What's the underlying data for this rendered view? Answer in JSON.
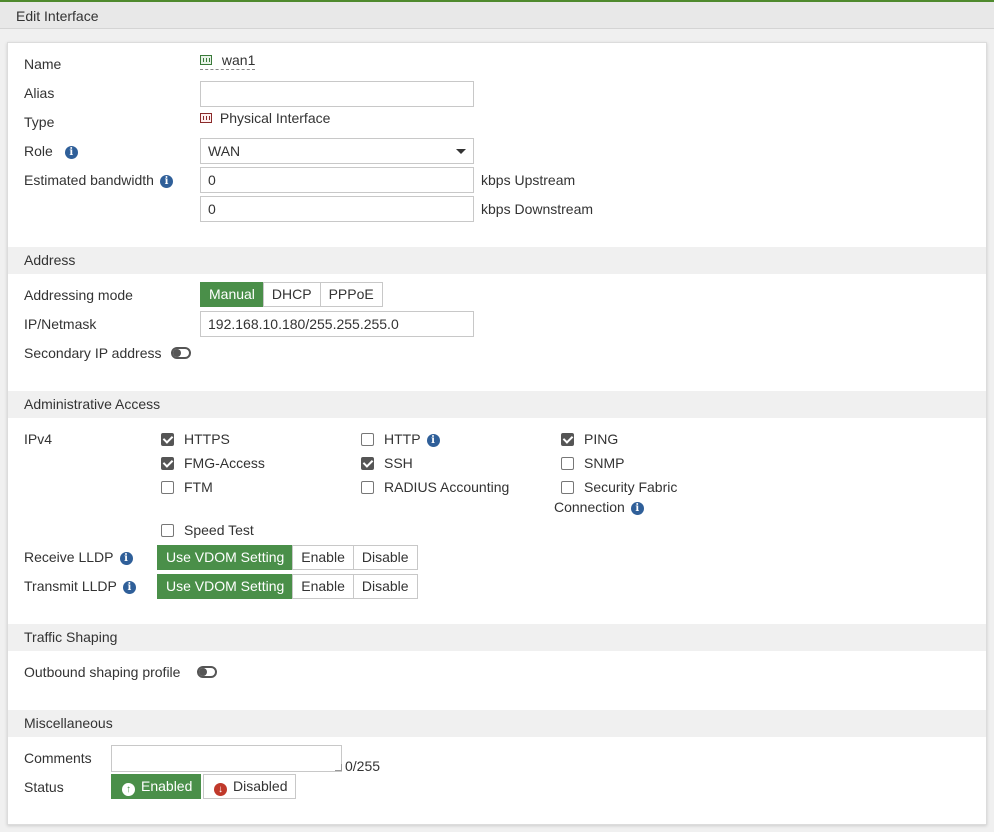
{
  "header": {
    "title": "Edit Interface"
  },
  "interface": {
    "name_label": "Name",
    "name_value": "wan1",
    "alias_label": "Alias",
    "alias_value": "",
    "type_label": "Type",
    "type_value": "Physical Interface",
    "role_label": "Role",
    "role_value": "WAN",
    "bandwidth_label": "Estimated bandwidth",
    "upstream_value": "0",
    "upstream_unit": "kbps Upstream",
    "downstream_value": "0",
    "downstream_unit": "kbps Downstream"
  },
  "address": {
    "section_title": "Address",
    "mode_label": "Addressing mode",
    "modes": [
      "Manual",
      "DHCP",
      "PPPoE"
    ],
    "selected_mode": "Manual",
    "ip_label": "IP/Netmask",
    "ip_value": "192.168.10.180/255.255.255.0",
    "secondary_label": "Secondary IP address",
    "secondary_enabled": false
  },
  "admin": {
    "section_title": "Administrative Access",
    "ipv4_label": "IPv4",
    "options": {
      "https": {
        "label": "HTTPS",
        "checked": true
      },
      "http": {
        "label": "HTTP",
        "checked": false
      },
      "ping": {
        "label": "PING",
        "checked": true
      },
      "fmg": {
        "label": "FMG-Access",
        "checked": true
      },
      "ssh": {
        "label": "SSH",
        "checked": true
      },
      "snmp": {
        "label": "SNMP",
        "checked": false
      },
      "ftm": {
        "label": "FTM",
        "checked": false
      },
      "radius": {
        "label": "RADIUS Accounting",
        "checked": false
      },
      "fabric_line1": "Security Fabric",
      "fabric_line2": "Connection",
      "fabric_checked": false,
      "speedtest": {
        "label": "Speed Test",
        "checked": false
      }
    },
    "receive_lldp_label": "Receive LLDP",
    "transmit_lldp_label": "Transmit LLDP",
    "lldp_options": [
      "Use VDOM Setting",
      "Enable",
      "Disable"
    ],
    "receive_selected": "Use VDOM Setting",
    "transmit_selected": "Use VDOM Setting"
  },
  "traffic": {
    "section_title": "Traffic Shaping",
    "outbound_label": "Outbound shaping profile",
    "outbound_enabled": false
  },
  "misc": {
    "section_title": "Miscellaneous",
    "comments_label": "Comments",
    "comments_value": "",
    "comments_counter": "0/255",
    "status_label": "Status",
    "enabled_label": "Enabled",
    "disabled_label": "Disabled",
    "status_selected": "Enabled"
  },
  "colors": {
    "accent_green": "#4a8f49",
    "info_blue": "#2f5f99",
    "disabled_red": "#c0392b"
  }
}
